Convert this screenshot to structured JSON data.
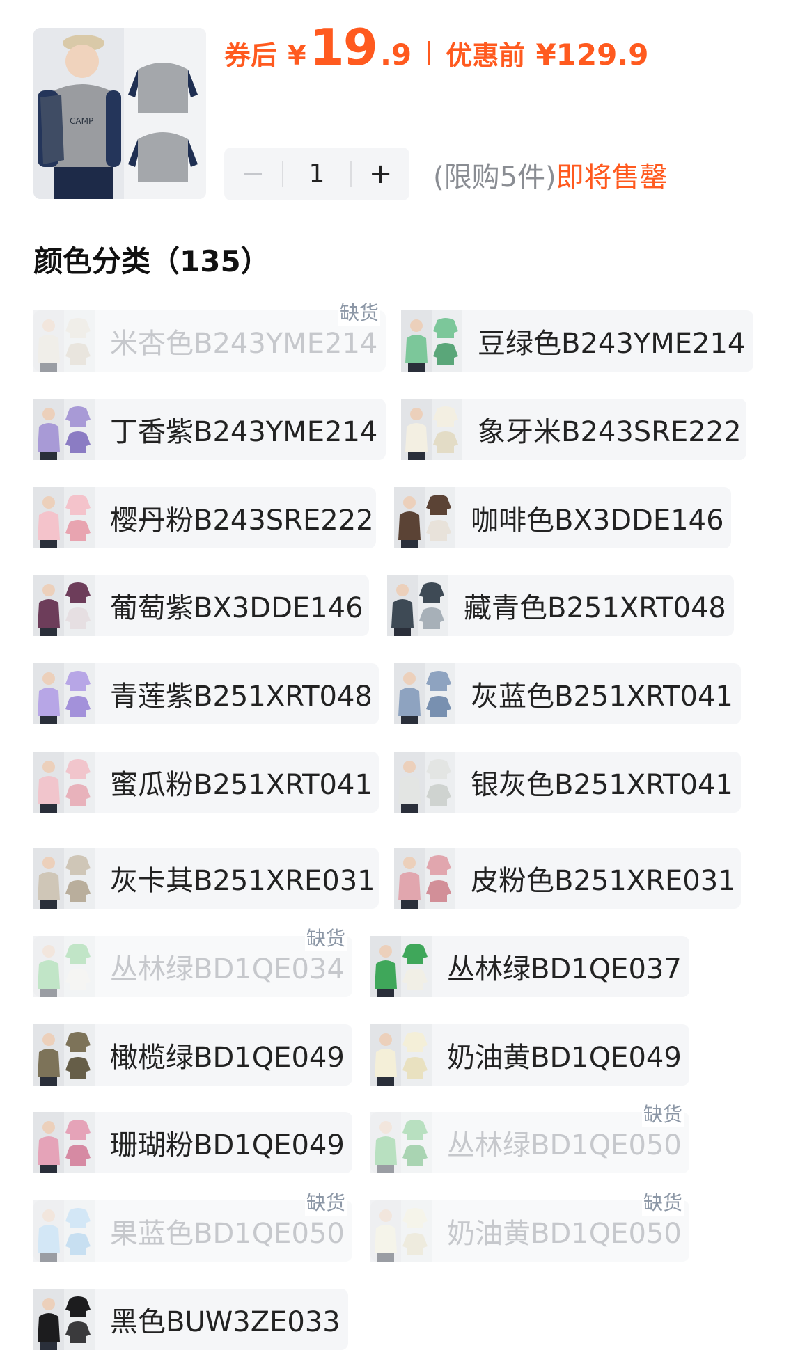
{
  "header": {
    "price_after_label": "券后",
    "currency": "¥",
    "price_big": "19",
    "price_small": ".9",
    "price_before_label": "优惠前",
    "price_before": "¥129.9",
    "stepper": {
      "minus": "−",
      "qty": "1",
      "plus": "+"
    },
    "limit_text": "(限购5件)",
    "stock_status": "即将售罄"
  },
  "section": {
    "title": "颜色分类（135）"
  },
  "oos_label": "缺货",
  "skus": [
    {
      "name": "米杏色B243YME214",
      "oos": true,
      "color": "#e7e2d6",
      "accent": "#d8cfbe"
    },
    {
      "name": "豆绿色B243YME214",
      "oos": false,
      "color": "#7cc79a",
      "accent": "#5aa679"
    },
    {
      "name": "丁香紫B243YME214",
      "oos": false,
      "color": "#a89ad6",
      "accent": "#8b7cc3"
    },
    {
      "name": "象牙米B243SRE222",
      "oos": false,
      "color": "#f3efe2",
      "accent": "#e3dcc6"
    },
    {
      "name": "樱丹粉B243SRE222",
      "oos": false,
      "color": "#f4c3cb",
      "accent": "#e8a4b0"
    },
    {
      "name": "咖啡色BX3DDE146",
      "oos": false,
      "color": "#5b4335",
      "accent": "#e8e2da"
    },
    {
      "name": "葡萄紫BX3DDE146",
      "oos": false,
      "color": "#6d3d5a",
      "accent": "#e6dfe2"
    },
    {
      "name": "藏青色B251XRT048",
      "oos": false,
      "color": "#3e4a55",
      "accent": "#a7b0b8"
    },
    {
      "name": "青莲紫B251XRT048",
      "oos": false,
      "color": "#b7a6e6",
      "accent": "#a391da"
    },
    {
      "name": "灰蓝色B251XRT041",
      "oos": false,
      "color": "#8ea3c0",
      "accent": "#7890b0"
    },
    {
      "name": "蜜瓜粉B251XRT041",
      "oos": false,
      "color": "#f1c5cc",
      "accent": "#e8b2bb"
    },
    {
      "name": "银灰色B251XRT041",
      "oos": false,
      "color": "#e3e5e3",
      "accent": "#cfd3d0"
    },
    {
      "name": "灰卡其B251XRE031",
      "oos": false,
      "color": "#cfc6b7",
      "accent": "#b9ae9c"
    },
    {
      "name": "皮粉色B251XRE031",
      "oos": false,
      "color": "#e1a6ae",
      "accent": "#d28f98"
    },
    {
      "name": "丛林绿BD1QE034",
      "oos": true,
      "color": "#7fcf8a",
      "accent": "#f2f2ec"
    },
    {
      "name": "丛林绿BD1QE037",
      "oos": false,
      "color": "#3fa75a",
      "accent": "#f1efe6"
    },
    {
      "name": "橄榄绿BD1QE049",
      "oos": false,
      "color": "#7d7359",
      "accent": "#665e48"
    },
    {
      "name": "奶油黄BD1QE049",
      "oos": false,
      "color": "#f4efd8",
      "accent": "#e9e1c0"
    },
    {
      "name": "珊瑚粉BD1QE049",
      "oos": false,
      "color": "#e5a3b8",
      "accent": "#d68aa3"
    },
    {
      "name": "丛林绿BD1QE050",
      "oos": true,
      "color": "#6cc27a",
      "accent": "#4aa85c"
    },
    {
      "name": "果蓝色BD1QE050",
      "oos": true,
      "color": "#a8d2f2",
      "accent": "#8cc0e8"
    },
    {
      "name": "奶油黄BD1QE050",
      "oos": true,
      "color": "#f3eed8",
      "accent": "#e2dbbd"
    },
    {
      "name": "黑色BUW3ZE033",
      "oos": false,
      "color": "#1c1c1e",
      "accent": "#3a3a3c"
    }
  ]
}
